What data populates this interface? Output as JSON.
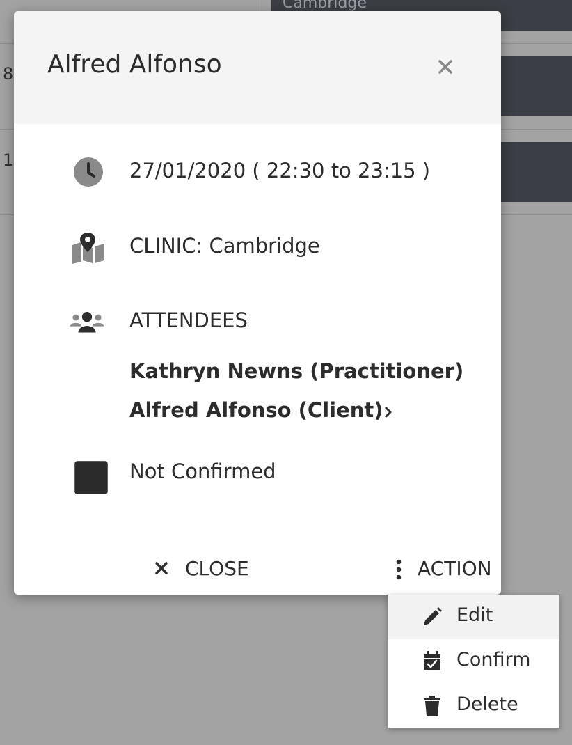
{
  "background": {
    "event_top_label": "Cambridge",
    "row_numbers": [
      "8",
      "1"
    ]
  },
  "modal": {
    "title": "Alfred Alfonso",
    "datetime": "27/01/2020 ( 22:30 to 23:15 )",
    "location": "CLINIC: Cambridge",
    "attendees_heading": "ATTENDEES",
    "attendees": [
      "Kathryn Newns (Practitioner)",
      "Alfred Alfonso (Client)"
    ],
    "status": "Not Confirmed",
    "close_label": "CLOSE",
    "action_label": "ACTION"
  },
  "menu": {
    "items": [
      {
        "label": "Edit",
        "icon": "pencil-icon"
      },
      {
        "label": "Confirm",
        "icon": "calendar-check-icon"
      },
      {
        "label": "Delete",
        "icon": "trash-icon"
      }
    ]
  },
  "colors": {
    "overlay": "#a3a3a3",
    "event": "#3b3f45",
    "text": "#2c2c2c",
    "icon_grey": "#8a8a8a"
  }
}
